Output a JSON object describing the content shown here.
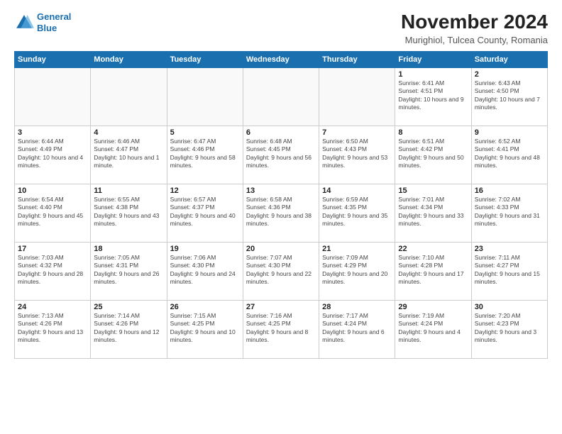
{
  "header": {
    "logo_line1": "General",
    "logo_line2": "Blue",
    "month_title": "November 2024",
    "location": "Murighiol, Tulcea County, Romania"
  },
  "weekdays": [
    "Sunday",
    "Monday",
    "Tuesday",
    "Wednesday",
    "Thursday",
    "Friday",
    "Saturday"
  ],
  "weeks": [
    [
      {
        "day": "",
        "info": ""
      },
      {
        "day": "",
        "info": ""
      },
      {
        "day": "",
        "info": ""
      },
      {
        "day": "",
        "info": ""
      },
      {
        "day": "",
        "info": ""
      },
      {
        "day": "1",
        "info": "Sunrise: 6:41 AM\nSunset: 4:51 PM\nDaylight: 10 hours and 9 minutes."
      },
      {
        "day": "2",
        "info": "Sunrise: 6:43 AM\nSunset: 4:50 PM\nDaylight: 10 hours and 7 minutes."
      }
    ],
    [
      {
        "day": "3",
        "info": "Sunrise: 6:44 AM\nSunset: 4:49 PM\nDaylight: 10 hours and 4 minutes."
      },
      {
        "day": "4",
        "info": "Sunrise: 6:46 AM\nSunset: 4:47 PM\nDaylight: 10 hours and 1 minute."
      },
      {
        "day": "5",
        "info": "Sunrise: 6:47 AM\nSunset: 4:46 PM\nDaylight: 9 hours and 58 minutes."
      },
      {
        "day": "6",
        "info": "Sunrise: 6:48 AM\nSunset: 4:45 PM\nDaylight: 9 hours and 56 minutes."
      },
      {
        "day": "7",
        "info": "Sunrise: 6:50 AM\nSunset: 4:43 PM\nDaylight: 9 hours and 53 minutes."
      },
      {
        "day": "8",
        "info": "Sunrise: 6:51 AM\nSunset: 4:42 PM\nDaylight: 9 hours and 50 minutes."
      },
      {
        "day": "9",
        "info": "Sunrise: 6:52 AM\nSunset: 4:41 PM\nDaylight: 9 hours and 48 minutes."
      }
    ],
    [
      {
        "day": "10",
        "info": "Sunrise: 6:54 AM\nSunset: 4:40 PM\nDaylight: 9 hours and 45 minutes."
      },
      {
        "day": "11",
        "info": "Sunrise: 6:55 AM\nSunset: 4:38 PM\nDaylight: 9 hours and 43 minutes."
      },
      {
        "day": "12",
        "info": "Sunrise: 6:57 AM\nSunset: 4:37 PM\nDaylight: 9 hours and 40 minutes."
      },
      {
        "day": "13",
        "info": "Sunrise: 6:58 AM\nSunset: 4:36 PM\nDaylight: 9 hours and 38 minutes."
      },
      {
        "day": "14",
        "info": "Sunrise: 6:59 AM\nSunset: 4:35 PM\nDaylight: 9 hours and 35 minutes."
      },
      {
        "day": "15",
        "info": "Sunrise: 7:01 AM\nSunset: 4:34 PM\nDaylight: 9 hours and 33 minutes."
      },
      {
        "day": "16",
        "info": "Sunrise: 7:02 AM\nSunset: 4:33 PM\nDaylight: 9 hours and 31 minutes."
      }
    ],
    [
      {
        "day": "17",
        "info": "Sunrise: 7:03 AM\nSunset: 4:32 PM\nDaylight: 9 hours and 28 minutes."
      },
      {
        "day": "18",
        "info": "Sunrise: 7:05 AM\nSunset: 4:31 PM\nDaylight: 9 hours and 26 minutes."
      },
      {
        "day": "19",
        "info": "Sunrise: 7:06 AM\nSunset: 4:30 PM\nDaylight: 9 hours and 24 minutes."
      },
      {
        "day": "20",
        "info": "Sunrise: 7:07 AM\nSunset: 4:30 PM\nDaylight: 9 hours and 22 minutes."
      },
      {
        "day": "21",
        "info": "Sunrise: 7:09 AM\nSunset: 4:29 PM\nDaylight: 9 hours and 20 minutes."
      },
      {
        "day": "22",
        "info": "Sunrise: 7:10 AM\nSunset: 4:28 PM\nDaylight: 9 hours and 17 minutes."
      },
      {
        "day": "23",
        "info": "Sunrise: 7:11 AM\nSunset: 4:27 PM\nDaylight: 9 hours and 15 minutes."
      }
    ],
    [
      {
        "day": "24",
        "info": "Sunrise: 7:13 AM\nSunset: 4:26 PM\nDaylight: 9 hours and 13 minutes."
      },
      {
        "day": "25",
        "info": "Sunrise: 7:14 AM\nSunset: 4:26 PM\nDaylight: 9 hours and 12 minutes."
      },
      {
        "day": "26",
        "info": "Sunrise: 7:15 AM\nSunset: 4:25 PM\nDaylight: 9 hours and 10 minutes."
      },
      {
        "day": "27",
        "info": "Sunrise: 7:16 AM\nSunset: 4:25 PM\nDaylight: 9 hours and 8 minutes."
      },
      {
        "day": "28",
        "info": "Sunrise: 7:17 AM\nSunset: 4:24 PM\nDaylight: 9 hours and 6 minutes."
      },
      {
        "day": "29",
        "info": "Sunrise: 7:19 AM\nSunset: 4:24 PM\nDaylight: 9 hours and 4 minutes."
      },
      {
        "day": "30",
        "info": "Sunrise: 7:20 AM\nSunset: 4:23 PM\nDaylight: 9 hours and 3 minutes."
      }
    ]
  ]
}
